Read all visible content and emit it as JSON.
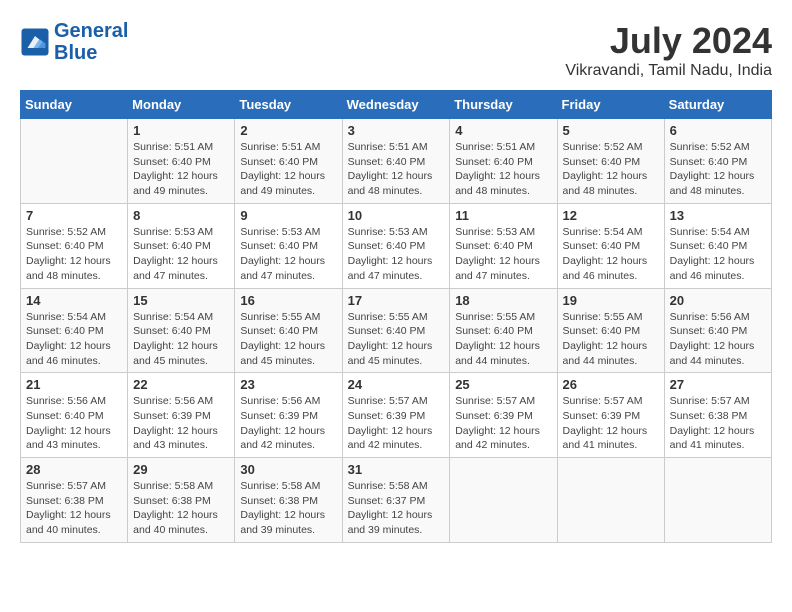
{
  "header": {
    "logo_line1": "General",
    "logo_line2": "Blue",
    "month": "July 2024",
    "location": "Vikravandi, Tamil Nadu, India"
  },
  "weekdays": [
    "Sunday",
    "Monday",
    "Tuesday",
    "Wednesday",
    "Thursday",
    "Friday",
    "Saturday"
  ],
  "weeks": [
    [
      {
        "day": "",
        "info": ""
      },
      {
        "day": "1",
        "info": "Sunrise: 5:51 AM\nSunset: 6:40 PM\nDaylight: 12 hours\nand 49 minutes."
      },
      {
        "day": "2",
        "info": "Sunrise: 5:51 AM\nSunset: 6:40 PM\nDaylight: 12 hours\nand 49 minutes."
      },
      {
        "day": "3",
        "info": "Sunrise: 5:51 AM\nSunset: 6:40 PM\nDaylight: 12 hours\nand 48 minutes."
      },
      {
        "day": "4",
        "info": "Sunrise: 5:51 AM\nSunset: 6:40 PM\nDaylight: 12 hours\nand 48 minutes."
      },
      {
        "day": "5",
        "info": "Sunrise: 5:52 AM\nSunset: 6:40 PM\nDaylight: 12 hours\nand 48 minutes."
      },
      {
        "day": "6",
        "info": "Sunrise: 5:52 AM\nSunset: 6:40 PM\nDaylight: 12 hours\nand 48 minutes."
      }
    ],
    [
      {
        "day": "7",
        "info": "Sunrise: 5:52 AM\nSunset: 6:40 PM\nDaylight: 12 hours\nand 48 minutes."
      },
      {
        "day": "8",
        "info": "Sunrise: 5:53 AM\nSunset: 6:40 PM\nDaylight: 12 hours\nand 47 minutes."
      },
      {
        "day": "9",
        "info": "Sunrise: 5:53 AM\nSunset: 6:40 PM\nDaylight: 12 hours\nand 47 minutes."
      },
      {
        "day": "10",
        "info": "Sunrise: 5:53 AM\nSunset: 6:40 PM\nDaylight: 12 hours\nand 47 minutes."
      },
      {
        "day": "11",
        "info": "Sunrise: 5:53 AM\nSunset: 6:40 PM\nDaylight: 12 hours\nand 47 minutes."
      },
      {
        "day": "12",
        "info": "Sunrise: 5:54 AM\nSunset: 6:40 PM\nDaylight: 12 hours\nand 46 minutes."
      },
      {
        "day": "13",
        "info": "Sunrise: 5:54 AM\nSunset: 6:40 PM\nDaylight: 12 hours\nand 46 minutes."
      }
    ],
    [
      {
        "day": "14",
        "info": "Sunrise: 5:54 AM\nSunset: 6:40 PM\nDaylight: 12 hours\nand 46 minutes."
      },
      {
        "day": "15",
        "info": "Sunrise: 5:54 AM\nSunset: 6:40 PM\nDaylight: 12 hours\nand 45 minutes."
      },
      {
        "day": "16",
        "info": "Sunrise: 5:55 AM\nSunset: 6:40 PM\nDaylight: 12 hours\nand 45 minutes."
      },
      {
        "day": "17",
        "info": "Sunrise: 5:55 AM\nSunset: 6:40 PM\nDaylight: 12 hours\nand 45 minutes."
      },
      {
        "day": "18",
        "info": "Sunrise: 5:55 AM\nSunset: 6:40 PM\nDaylight: 12 hours\nand 44 minutes."
      },
      {
        "day": "19",
        "info": "Sunrise: 5:55 AM\nSunset: 6:40 PM\nDaylight: 12 hours\nand 44 minutes."
      },
      {
        "day": "20",
        "info": "Sunrise: 5:56 AM\nSunset: 6:40 PM\nDaylight: 12 hours\nand 44 minutes."
      }
    ],
    [
      {
        "day": "21",
        "info": "Sunrise: 5:56 AM\nSunset: 6:40 PM\nDaylight: 12 hours\nand 43 minutes."
      },
      {
        "day": "22",
        "info": "Sunrise: 5:56 AM\nSunset: 6:39 PM\nDaylight: 12 hours\nand 43 minutes."
      },
      {
        "day": "23",
        "info": "Sunrise: 5:56 AM\nSunset: 6:39 PM\nDaylight: 12 hours\nand 42 minutes."
      },
      {
        "day": "24",
        "info": "Sunrise: 5:57 AM\nSunset: 6:39 PM\nDaylight: 12 hours\nand 42 minutes."
      },
      {
        "day": "25",
        "info": "Sunrise: 5:57 AM\nSunset: 6:39 PM\nDaylight: 12 hours\nand 42 minutes."
      },
      {
        "day": "26",
        "info": "Sunrise: 5:57 AM\nSunset: 6:39 PM\nDaylight: 12 hours\nand 41 minutes."
      },
      {
        "day": "27",
        "info": "Sunrise: 5:57 AM\nSunset: 6:38 PM\nDaylight: 12 hours\nand 41 minutes."
      }
    ],
    [
      {
        "day": "28",
        "info": "Sunrise: 5:57 AM\nSunset: 6:38 PM\nDaylight: 12 hours\nand 40 minutes."
      },
      {
        "day": "29",
        "info": "Sunrise: 5:58 AM\nSunset: 6:38 PM\nDaylight: 12 hours\nand 40 minutes."
      },
      {
        "day": "30",
        "info": "Sunrise: 5:58 AM\nSunset: 6:38 PM\nDaylight: 12 hours\nand 39 minutes."
      },
      {
        "day": "31",
        "info": "Sunrise: 5:58 AM\nSunset: 6:37 PM\nDaylight: 12 hours\nand 39 minutes."
      },
      {
        "day": "",
        "info": ""
      },
      {
        "day": "",
        "info": ""
      },
      {
        "day": "",
        "info": ""
      }
    ]
  ]
}
